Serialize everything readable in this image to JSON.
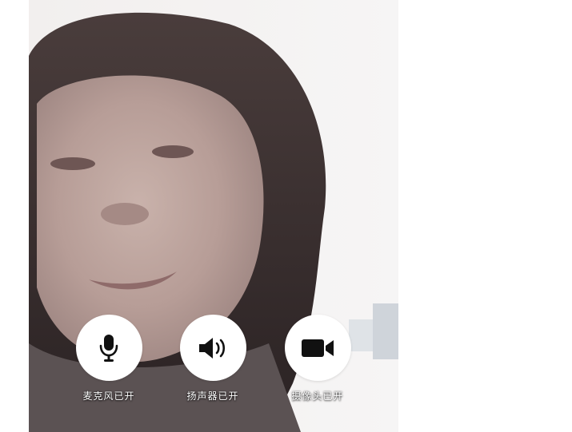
{
  "controls": {
    "mic": {
      "label": "麦克风已开",
      "icon": "microphone-icon",
      "state": "on"
    },
    "speaker": {
      "label": "扬声器已开",
      "icon": "speaker-icon",
      "state": "on"
    },
    "camera": {
      "label": "摄像头已开",
      "icon": "video-camera-icon",
      "state": "on"
    }
  },
  "colors": {
    "button_bg": "#ffffff",
    "icon": "#111111",
    "label": "#ffffff"
  }
}
